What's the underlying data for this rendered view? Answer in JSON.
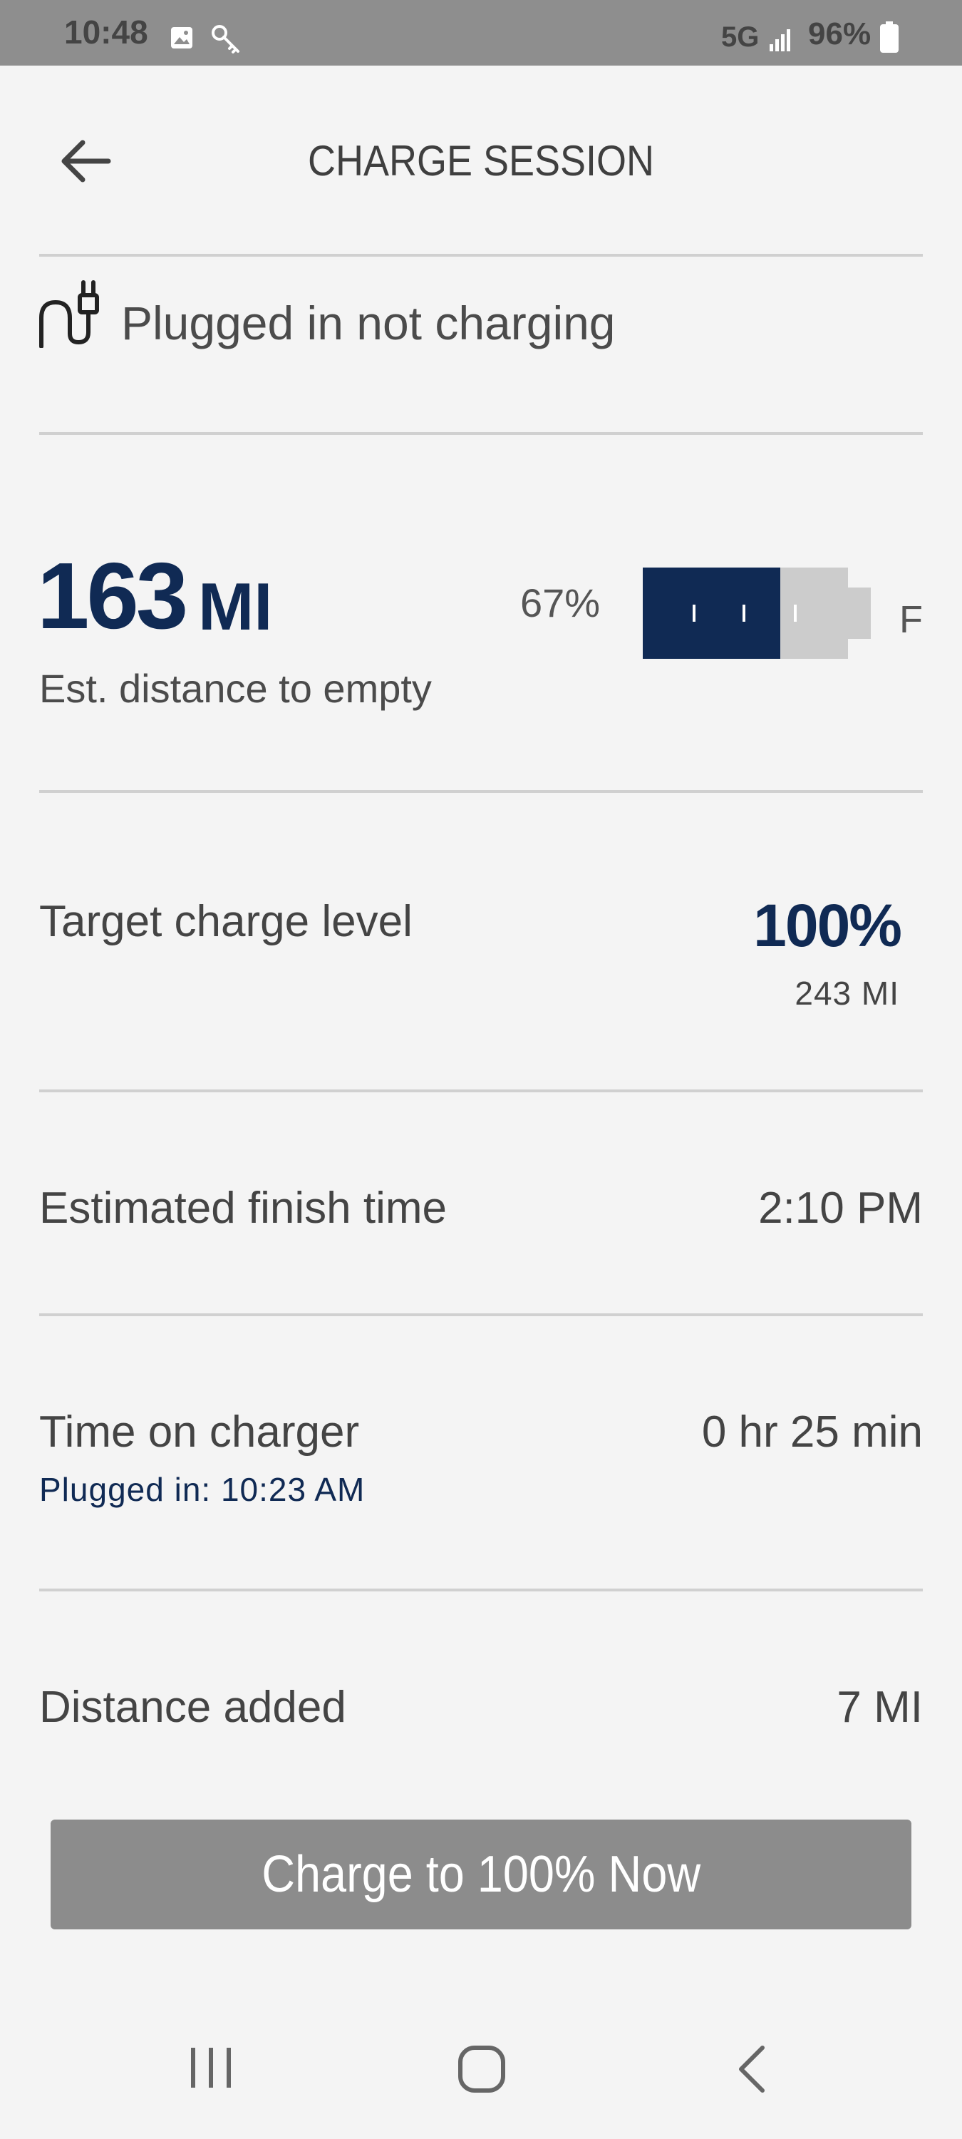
{
  "status_bar": {
    "time": "10:48",
    "network": "5G",
    "battery": "96%",
    "icons": [
      "gallery-icon",
      "key-icon",
      "signal-icon",
      "battery-icon"
    ]
  },
  "header": {
    "title": "CHARGE SESSION",
    "back_icon": "arrow-left-icon"
  },
  "plug": {
    "icon": "plug-icon",
    "status": "Plugged in not charging"
  },
  "range": {
    "value": "163",
    "unit": "MI",
    "label": "Est. distance to empty",
    "battery_percent": "67%",
    "battery_level": 0.67,
    "full_label": "F"
  },
  "rows": {
    "target": {
      "label": "Target charge level",
      "percent": "100%",
      "distance": "243 MI"
    },
    "finish": {
      "label": "Estimated finish time",
      "value": "2:10 PM"
    },
    "time_on_charger": {
      "label": "Time on charger",
      "value": "0 hr 25 min",
      "sub": "Plugged in: 10:23 AM"
    },
    "distance_added": {
      "label": "Distance added",
      "value": "7 MI"
    }
  },
  "button": {
    "label": "Charge to 100% Now"
  },
  "nav": {
    "icons": [
      "recent-apps-icon",
      "home-icon",
      "back-icon"
    ]
  },
  "colors": {
    "accent_navy": "#102a54",
    "status_bar": "#8e8e8e",
    "button_bg": "#8c8c8c",
    "background": "#f4f4f4"
  }
}
